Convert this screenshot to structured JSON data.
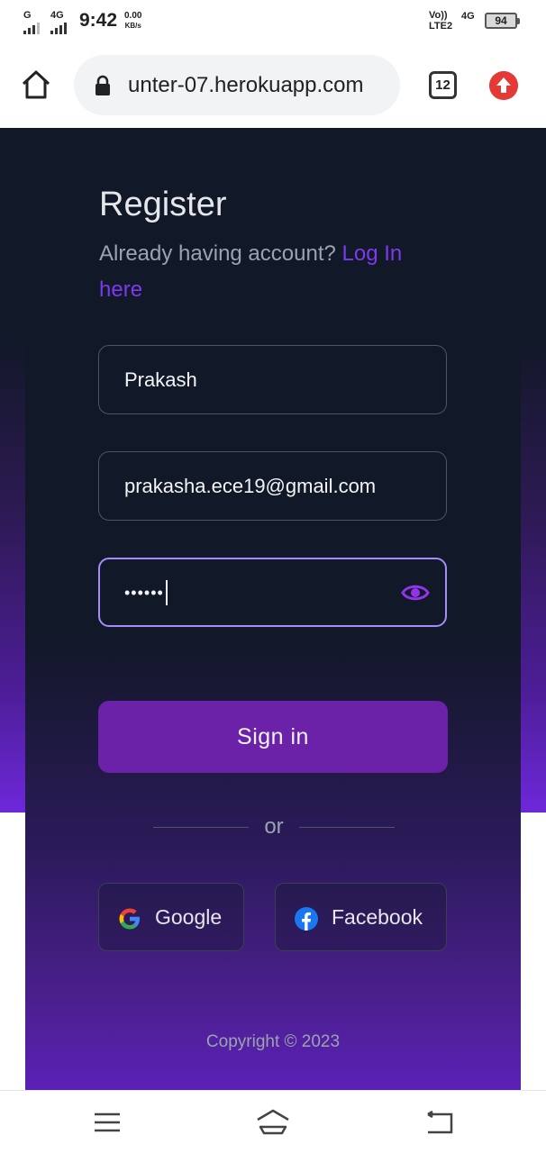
{
  "status_bar": {
    "signal1_label": "G",
    "signal2_label": "4G",
    "time": "9:42",
    "speed_value": "0.00",
    "speed_unit": "KB/s",
    "volte_top": "Vo))",
    "volte_bottom": "LTE2",
    "network": "4G",
    "battery": "94"
  },
  "browser": {
    "url": "unter-07.herokuapp.com",
    "tab_count": "12"
  },
  "register": {
    "title": "Register",
    "subtitle": "Already having account?",
    "login_link": "Log In here",
    "name_value": "Prakash",
    "email_value": "prakasha.ece19@gmail.com",
    "password_value": "••••••",
    "signin_label": "Sign in",
    "or_label": "or",
    "google_label": "Google",
    "facebook_label": "Facebook",
    "copyright": "Copyright © 2023"
  },
  "colors": {
    "accent": "#6b21a8",
    "link": "#7c3aed",
    "focus_border": "#a78bfa",
    "card_bg": "#111827"
  }
}
